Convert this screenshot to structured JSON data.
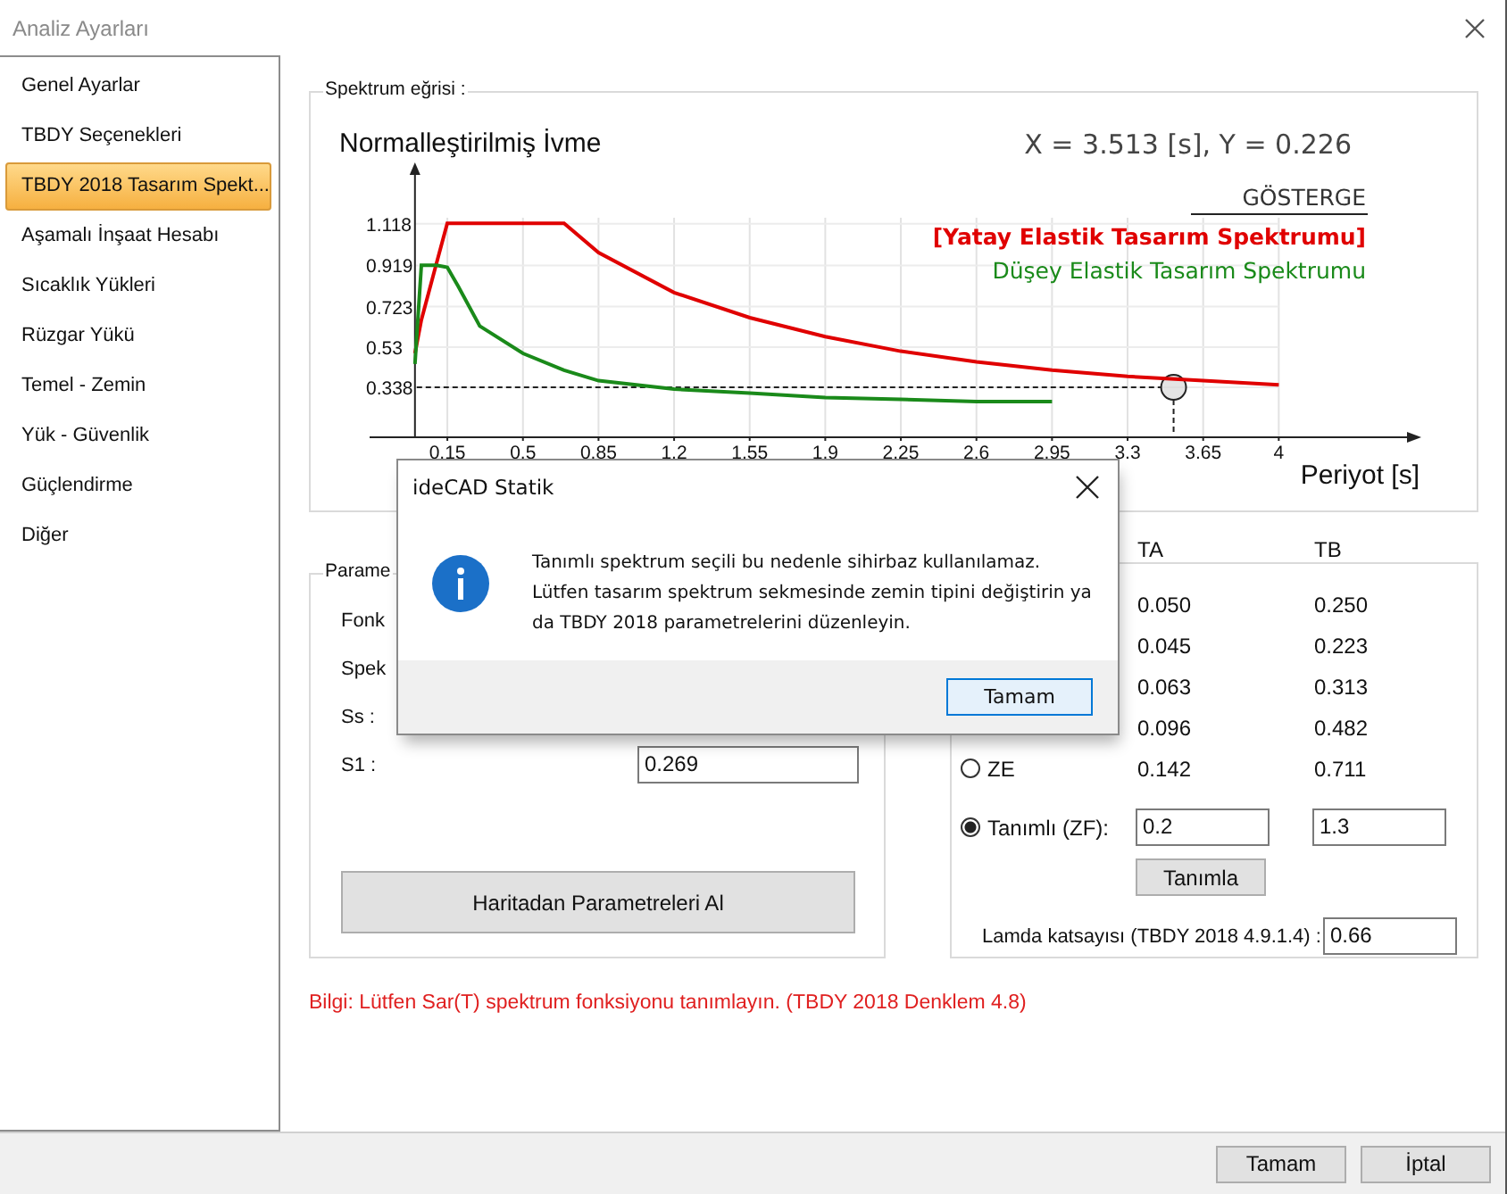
{
  "window": {
    "title": "Analiz Ayarları"
  },
  "sidebar": {
    "items": [
      {
        "label": "Genel Ayarlar",
        "selected": false
      },
      {
        "label": "TBDY Seçenekleri",
        "selected": false
      },
      {
        "label": "TBDY 2018 Tasarım Spekt...",
        "selected": true
      },
      {
        "label": "Aşamalı İnşaat Hesabı",
        "selected": false
      },
      {
        "label": "Sıcaklık Yükleri",
        "selected": false
      },
      {
        "label": "Rüzgar Yükü",
        "selected": false
      },
      {
        "label": "Temel - Zemin",
        "selected": false
      },
      {
        "label": "Yük - Güvenlik",
        "selected": false
      },
      {
        "label": "Güçlendirme",
        "selected": false
      },
      {
        "label": "Diğer",
        "selected": false
      }
    ]
  },
  "spectrum_group": {
    "title": "Spektrum eğrisi :",
    "y_axis_title": "Normalleştirilmiş İvme",
    "x_axis_title": "Periyot [s]",
    "legend_title": "GÖSTERGE",
    "legend_entries": [
      {
        "selected": true
      },
      {
        "selected": false
      }
    ],
    "chart_data": {
      "type": "line",
      "x": [
        0,
        0.03,
        0.1,
        0.15,
        0.2,
        0.3,
        0.5,
        0.69,
        0.85,
        1.2,
        1.55,
        1.9,
        2.25,
        2.6,
        2.95,
        3.3,
        3.65,
        4
      ],
      "series": [
        {
          "name": "[Yatay Elastik Tasarım Spektrumu]",
          "color": "#e00000",
          "values": [
            0.5,
            0.66,
            0.93,
            1.12,
            1.12,
            1.12,
            1.12,
            1.12,
            0.98,
            0.79,
            0.67,
            0.58,
            0.51,
            0.46,
            0.42,
            0.39,
            0.37,
            0.35
          ]
        },
        {
          "name": "Düşey Elastik Tasarım Spektrumu",
          "color": "#1a8a1a",
          "values": [
            0.45,
            0.92,
            0.92,
            0.91,
            0.82,
            0.63,
            0.5,
            0.42,
            0.37,
            0.33,
            0.31,
            0.29,
            0.28,
            0.27,
            0.27,
            null,
            null,
            null
          ]
        }
      ],
      "xlim": [
        -0.21,
        4.66
      ],
      "ylim": [
        0.1,
        1.41
      ],
      "grid": true,
      "xticks": [
        0.15,
        0.5,
        0.85,
        1.2,
        1.55,
        1.9,
        2.25,
        2.6,
        2.95,
        3.3,
        3.65,
        4
      ],
      "yticks": [
        1.118,
        0.919,
        0.723,
        0.53,
        0.338
      ],
      "ref_lines": [
        {
          "axis": "y",
          "value": 0.338
        },
        {
          "axis": "x",
          "value": 3.513
        }
      ],
      "annotations": [
        "X = 3.513 [s],  Y = 0.226"
      ]
    }
  },
  "parameters_group": {
    "title": "Parame",
    "rows": [
      {
        "label": "Fonk"
      },
      {
        "label": "Spek"
      },
      {
        "label": "Ss :"
      },
      {
        "label": "S1 :",
        "value": "0.269"
      }
    ],
    "button": "Haritadan Parametreleri Al"
  },
  "soil_group": {
    "columns": [
      "TA",
      "TB"
    ],
    "rows": [
      {
        "kind": "values",
        "ta": "0.050",
        "tb": "0.250"
      },
      {
        "kind": "values",
        "ta": "0.045",
        "tb": "0.223"
      },
      {
        "kind": "values",
        "ta": "0.063",
        "tb": "0.313"
      },
      {
        "kind": "values",
        "ta": "0.096",
        "tb": "0.482"
      },
      {
        "kind": "radio",
        "label": "ZE",
        "selected": false,
        "ta": "0.142",
        "tb": "0.711"
      },
      {
        "kind": "input",
        "label": "Tanımlı (ZF):",
        "selected": true,
        "ta": "0.2",
        "tb": "1.3"
      }
    ],
    "define_button": "Tanımla",
    "lambda": {
      "label": "Lamda katsayısı (TBDY 2018 4.9.1.4) :",
      "value": "0.66"
    }
  },
  "info_text": "Bilgi: Lütfen Sar(T) spektrum fonksiyonu tanımlayın. (TBDY 2018 Denklem 4.8)",
  "footer": {
    "buttons": [
      "Tamam",
      "İptal"
    ]
  },
  "dialog": {
    "title": "ideCAD Statik",
    "message_lines": [
      "Tanımlı spektrum seçili bu nedenle sihirbaz kullanılamaz.",
      "Lütfen tasarım spektrum sekmesinde zemin tipini değiştirin ya",
      "da TBDY 2018 parametrelerini düzenleyin."
    ],
    "buttons": [
      {
        "label": "Tamam",
        "default": true
      }
    ]
  }
}
